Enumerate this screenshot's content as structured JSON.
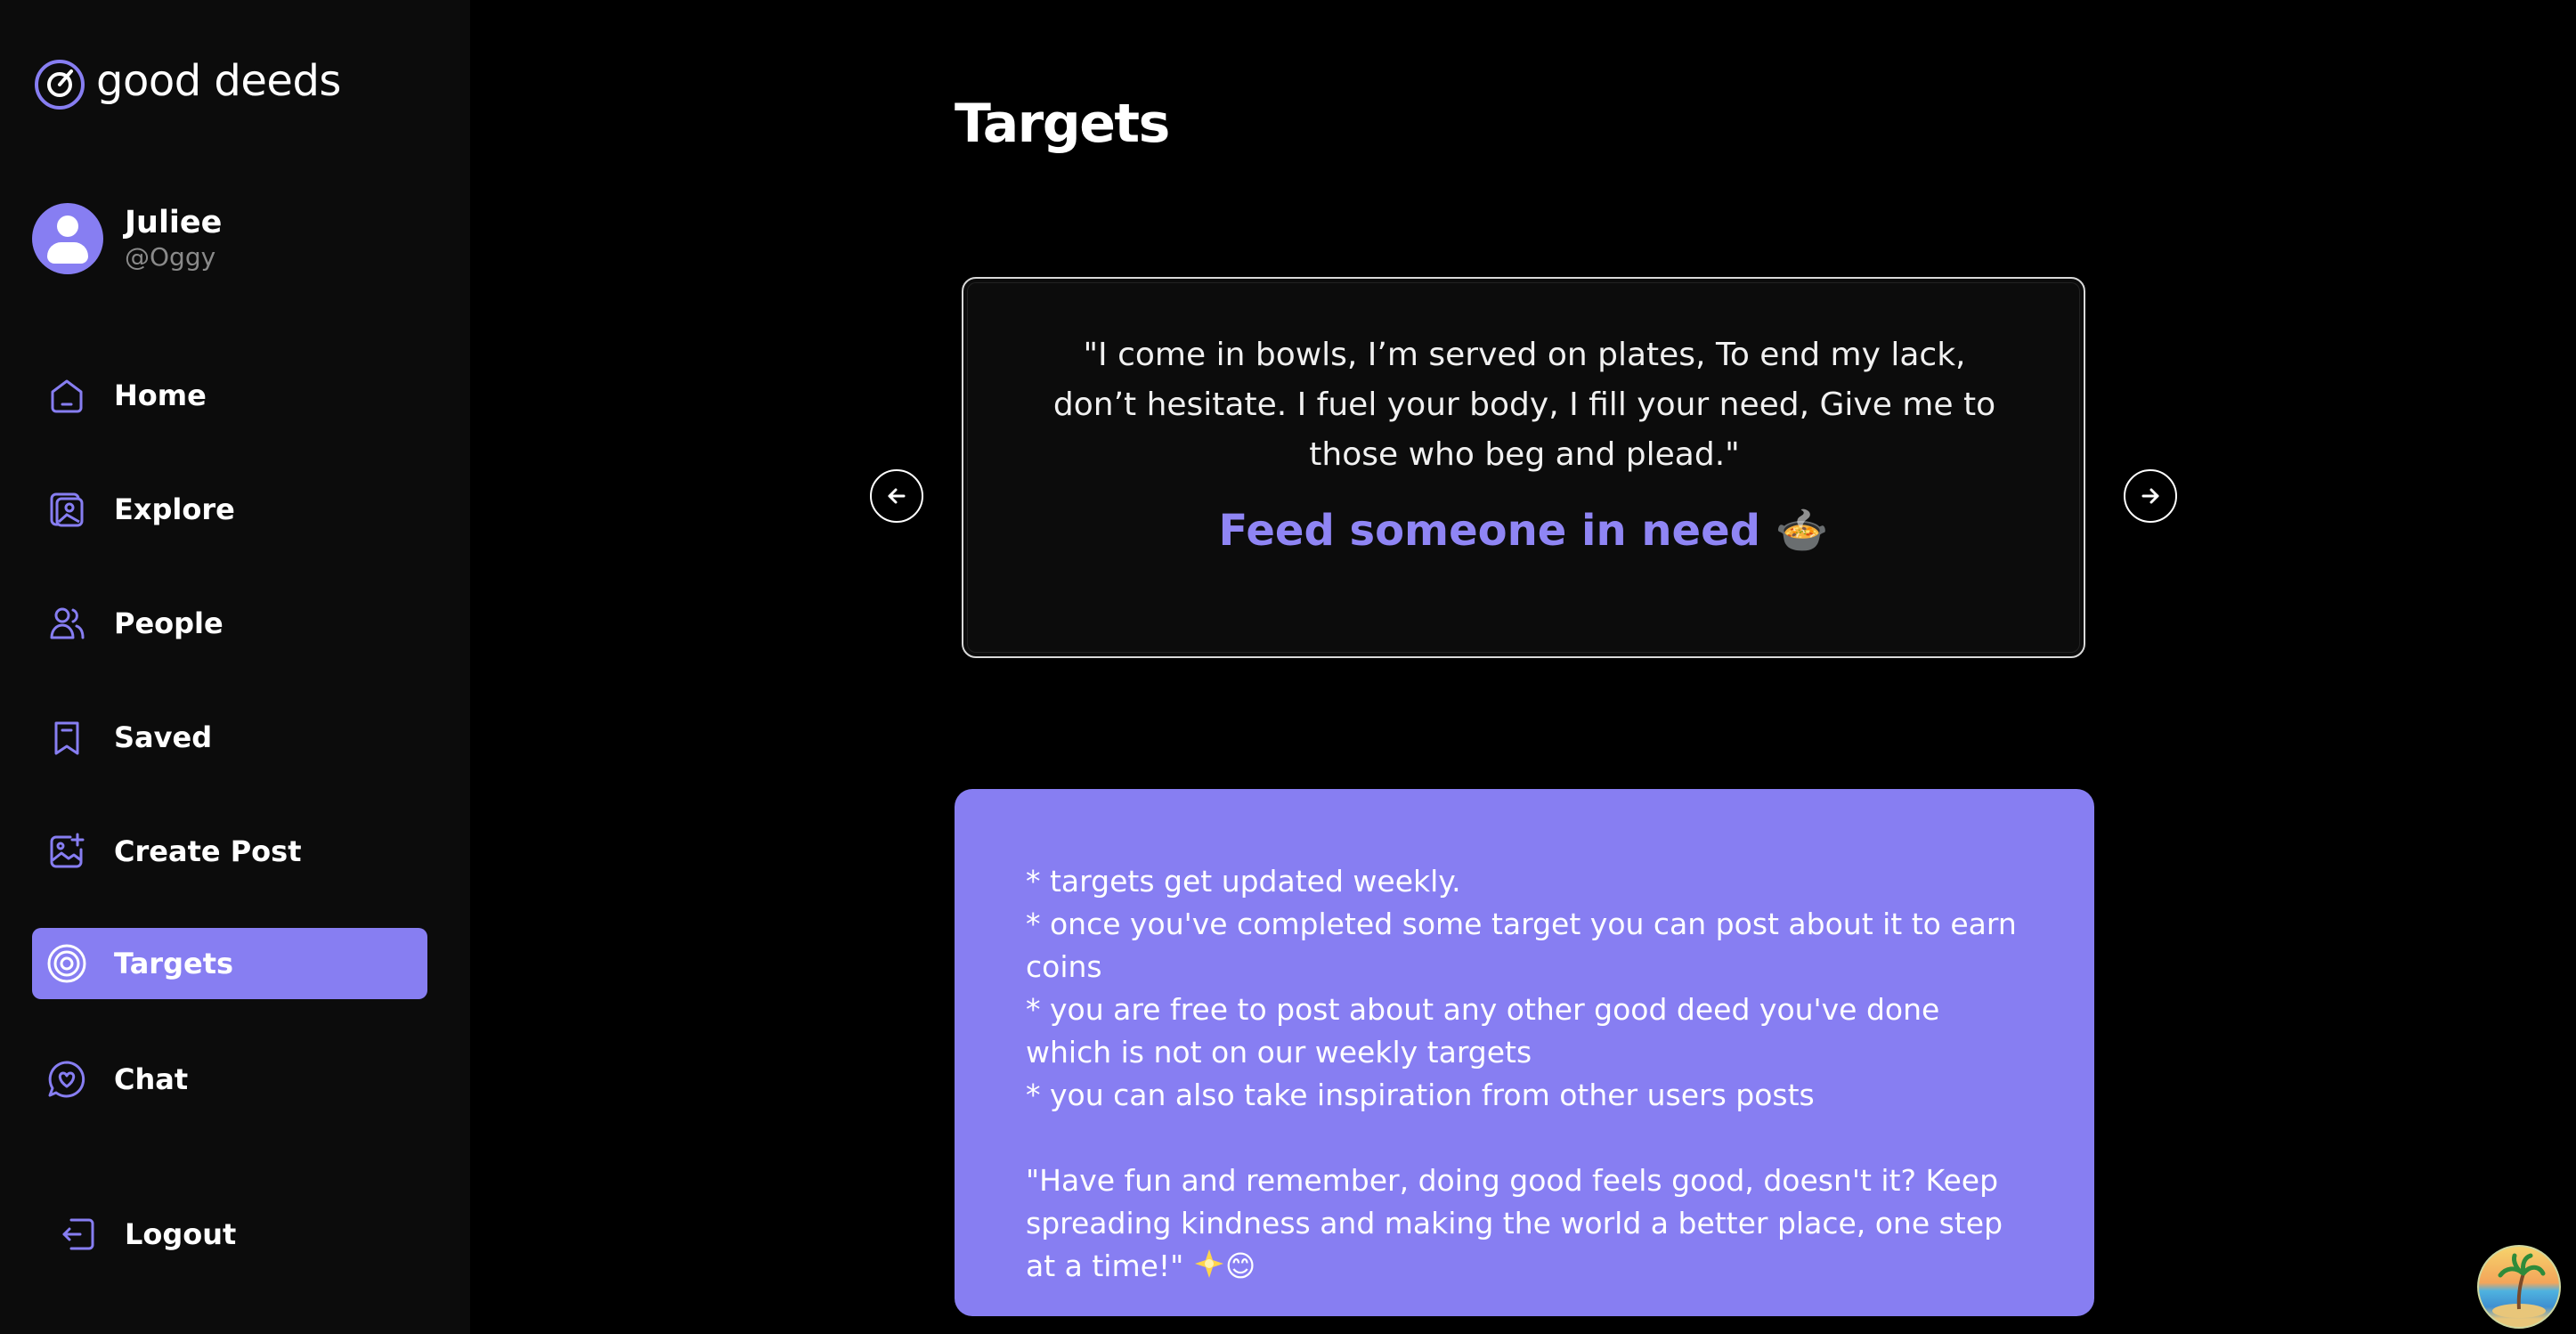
{
  "brand": {
    "name": "good deeds",
    "icon": "target-logo-icon",
    "accent_color": "#877ef2"
  },
  "profile": {
    "name": "Juliee",
    "handle": "@Oggy"
  },
  "nav": {
    "items": [
      {
        "label": "Home",
        "icon": "home-icon"
      },
      {
        "label": "Explore",
        "icon": "gallery-icon"
      },
      {
        "label": "People",
        "icon": "people-icon"
      },
      {
        "label": "Saved",
        "icon": "bookmark-icon"
      },
      {
        "label": "Create Post",
        "icon": "add-image-icon"
      },
      {
        "label": "Targets",
        "icon": "target-icon",
        "active": true
      },
      {
        "label": "Chat",
        "icon": "chat-heart-icon"
      }
    ],
    "logout_label": "Logout"
  },
  "page": {
    "title": "Targets"
  },
  "carousel": {
    "riddle": "\"I come in bowls, I’m served on plates, To end my lack, don’t hesitate. I fuel your body, I fill your need, Give me to those who beg and plead.\"",
    "target_title": "Feed someone in need 🍲"
  },
  "info": {
    "lines": [
      "* targets get updated weekly.",
      "* once you've completed some target you can post about it to earn coins",
      "* you are free to post about any other good deed you've done which is not on our weekly targets",
      "* you can also take inspiration from other users posts"
    ],
    "quote": "\"Have fun and remember, doing good feels good, doesn't it? Keep spreading kindness and making the world a better place, one step at a time!\"",
    "quote_emoji": "😊"
  }
}
